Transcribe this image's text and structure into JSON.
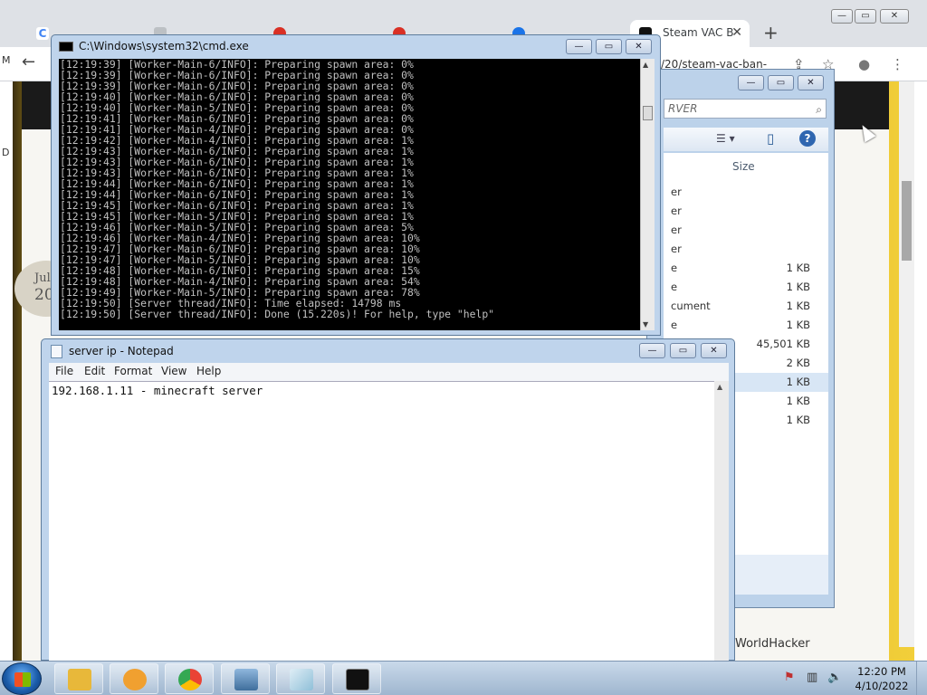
{
  "browser": {
    "tabs": [
      {
        "label": "C",
        "color": "#4285f4"
      },
      {
        "label": "",
        "color": "#9aa0a6"
      },
      {
        "label": "",
        "color": "#d93025"
      },
      {
        "label": "",
        "color": "#d93025"
      },
      {
        "label": "",
        "color": "#1a73e8"
      },
      {
        "label": "Steam VAC B",
        "color": "#111111"
      }
    ],
    "active_tab_close": "✕",
    "new_tab": "+",
    "back": "←",
    "url_fragment": "/20/steam-vac-ban-",
    "share_icon": "⇪",
    "star_icon": "☆",
    "profile_icon": "●",
    "menu_icon": "⋮",
    "window_controls": [
      "—",
      "▭",
      "✕"
    ],
    "page": {
      "date_month": "Jul",
      "date_year": "20",
      "footer_text": "WorldHacker",
      "edge_m": "M",
      "edge_d": "D"
    }
  },
  "explorer": {
    "window_controls": [
      "—",
      "▭",
      "✕"
    ],
    "search_placeholder": "RVER",
    "search_icon": "⌕",
    "view_icon": "☰ ▾",
    "pane_icon": "▯",
    "help_icon": "?",
    "size_header": "Size",
    "rows": [
      {
        "name": "er",
        "size": ""
      },
      {
        "name": "er",
        "size": ""
      },
      {
        "name": "er",
        "size": ""
      },
      {
        "name": "er",
        "size": ""
      },
      {
        "name": "e",
        "size": "1 KB"
      },
      {
        "name": "e",
        "size": "1 KB"
      },
      {
        "name": "cument",
        "size": "1 KB"
      },
      {
        "name": "e",
        "size": "1 KB"
      },
      {
        "name": "",
        "size": "45,501 KB"
      },
      {
        "name": "",
        "size": "2 KB"
      },
      {
        "name": "",
        "size": "1 KB"
      },
      {
        "name": "",
        "size": "1 KB"
      },
      {
        "name": "",
        "size": "1 KB"
      }
    ]
  },
  "cmd": {
    "title": "C:\\Windows\\system32\\cmd.exe",
    "window_controls": [
      "—",
      "▭",
      "✕"
    ],
    "lines": [
      "[12:19:39] [Worker-Main-6/INFO]: Preparing spawn area: 0%",
      "[12:19:39] [Worker-Main-6/INFO]: Preparing spawn area: 0%",
      "[12:19:39] [Worker-Main-6/INFO]: Preparing spawn area: 0%",
      "[12:19:40] [Worker-Main-6/INFO]: Preparing spawn area: 0%",
      "[12:19:40] [Worker-Main-5/INFO]: Preparing spawn area: 0%",
      "[12:19:41] [Worker-Main-6/INFO]: Preparing spawn area: 0%",
      "[12:19:41] [Worker-Main-4/INFO]: Preparing spawn area: 0%",
      "[12:19:42] [Worker-Main-4/INFO]: Preparing spawn area: 1%",
      "[12:19:43] [Worker-Main-6/INFO]: Preparing spawn area: 1%",
      "[12:19:43] [Worker-Main-6/INFO]: Preparing spawn area: 1%",
      "[12:19:43] [Worker-Main-6/INFO]: Preparing spawn area: 1%",
      "[12:19:44] [Worker-Main-6/INFO]: Preparing spawn area: 1%",
      "[12:19:44] [Worker-Main-6/INFO]: Preparing spawn area: 1%",
      "[12:19:45] [Worker-Main-6/INFO]: Preparing spawn area: 1%",
      "[12:19:45] [Worker-Main-5/INFO]: Preparing spawn area: 1%",
      "[12:19:46] [Worker-Main-5/INFO]: Preparing spawn area: 5%",
      "[12:19:46] [Worker-Main-4/INFO]: Preparing spawn area: 10%",
      "[12:19:47] [Worker-Main-6/INFO]: Preparing spawn area: 10%",
      "[12:19:47] [Worker-Main-5/INFO]: Preparing spawn area: 10%",
      "[12:19:48] [Worker-Main-6/INFO]: Preparing spawn area: 15%",
      "[12:19:48] [Worker-Main-4/INFO]: Preparing spawn area: 54%",
      "[12:19:49] [Worker-Main-5/INFO]: Preparing spawn area: 78%",
      "[12:19:50] [Server thread/INFO]: Time elapsed: 14798 ms",
      "[12:19:50] [Server thread/INFO]: Done (15.220s)! For help, type \"help\""
    ],
    "scroll_up": "▲",
    "scroll_down": "▼"
  },
  "notepad": {
    "title": "server ip - Notepad",
    "window_controls": [
      "—",
      "▭",
      "✕"
    ],
    "menu": [
      "File",
      "Edit",
      "Format",
      "View",
      "Help"
    ],
    "content": "192.168.1.11 - minecraft server",
    "scroll_up": "▲"
  },
  "taskbar": {
    "items": [
      {
        "name": "explorer",
        "color": "#e8b83a"
      },
      {
        "name": "media-player",
        "color": "#f0a030"
      },
      {
        "name": "chrome",
        "color": "#34a853"
      },
      {
        "name": "photo-viewer",
        "color": "#5a8fc0"
      },
      {
        "name": "notepad",
        "color": "#9ec9df"
      },
      {
        "name": "cmd",
        "color": "#111111"
      }
    ],
    "tray": {
      "flag": "⚑",
      "network": "▥",
      "volume": "🔈"
    },
    "time": "12:20 PM",
    "date": "4/10/2022"
  }
}
